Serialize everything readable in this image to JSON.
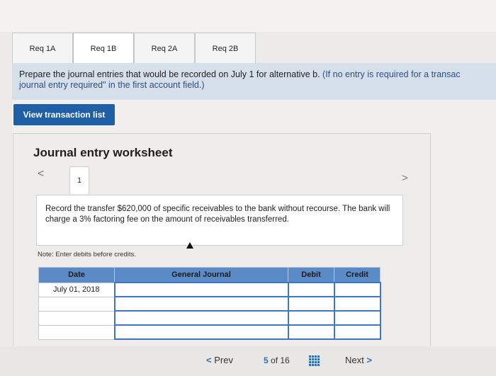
{
  "tabs": [
    {
      "label": "Req 1A"
    },
    {
      "label": "Req 1B"
    },
    {
      "label": "Req 2A"
    },
    {
      "label": "Req 2B"
    }
  ],
  "instruction": {
    "main": "Prepare the journal entries that would be recorded on July 1 for alternative b.",
    "note_part1": "(If no entry is required for a transac",
    "note_part2": "journal entry required\" in the first account field.)"
  },
  "view_button": "View transaction list",
  "worksheet": {
    "title": "Journal entry worksheet",
    "prev_arrow": "<",
    "next_arrow": ">",
    "page_tab": "1",
    "description": "Record the transfer $620,000 of specific receivables to the bank without recourse. The bank will charge a 3% factoring fee on the amount of receivables transferred.",
    "note": "Note: Enter debits before credits."
  },
  "table": {
    "headers": {
      "date": "Date",
      "journal": "General Journal",
      "debit": "Debit",
      "credit": "Credit"
    },
    "first_date": "July 01, 2018"
  },
  "footer": {
    "prev_label": "Prev",
    "prev_chevron": "<",
    "page_current": "5",
    "page_of": "of 16",
    "next_label": "Next",
    "next_chevron": ">"
  }
}
